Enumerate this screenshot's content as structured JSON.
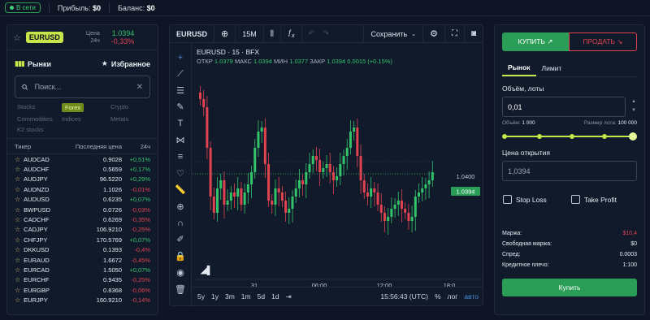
{
  "topbar": {
    "status": "В сети",
    "profit_label": "Прибыль:",
    "profit_value": "$0",
    "balance_label": "Баланс:",
    "balance_value": "$0"
  },
  "instrument": {
    "symbol": "EURUSD",
    "price_label": "Цена",
    "period_label": "24ч",
    "price": "1.0394",
    "change": "-0,33%"
  },
  "markets": {
    "title": "Рынки",
    "favorites": "Избранное",
    "search_placeholder": "Поиск...",
    "categories": [
      {
        "label": "Stocks",
        "active": false
      },
      {
        "label": "Forex",
        "active": true
      },
      {
        "label": "Crypto",
        "active": false
      },
      {
        "label": "Commodities",
        "active": false
      },
      {
        "label": "Indices",
        "active": false
      },
      {
        "label": "Metals",
        "active": false
      },
      {
        "label": "K2 stocks",
        "active": false
      }
    ],
    "columns": {
      "ticker": "Тикер",
      "last_price": "Последняя цена",
      "change": "24ч"
    },
    "rows": [
      {
        "ticker": "AUDCAD",
        "price": "0.9028",
        "change": "+0,51%",
        "dir": "up"
      },
      {
        "ticker": "AUDCHF",
        "price": "0.5659",
        "change": "+0,17%",
        "dir": "up"
      },
      {
        "ticker": "AUDJPY",
        "price": "96.5220",
        "change": "+0,29%",
        "dir": "up"
      },
      {
        "ticker": "AUDNZD",
        "price": "1.1026",
        "change": "-0,01%",
        "dir": "down"
      },
      {
        "ticker": "AUDUSD",
        "price": "0.6235",
        "change": "+0,07%",
        "dir": "up"
      },
      {
        "ticker": "BWPUSD",
        "price": "0.0726",
        "change": "-0,03%",
        "dir": "down"
      },
      {
        "ticker": "CADCHF",
        "price": "0.6269",
        "change": "-0,35%",
        "dir": "down"
      },
      {
        "ticker": "CADJPY",
        "price": "106.9210",
        "change": "-0,25%",
        "dir": "down"
      },
      {
        "ticker": "CHFJPY",
        "price": "170.5769",
        "change": "+0,07%",
        "dir": "up"
      },
      {
        "ticker": "DKKUSD",
        "price": "0.1393",
        "change": "-0,4%",
        "dir": "down"
      },
      {
        "ticker": "EURAUD",
        "price": "1.6672",
        "change": "-0,45%",
        "dir": "down"
      },
      {
        "ticker": "EURCAD",
        "price": "1.5050",
        "change": "+0,07%",
        "dir": "up"
      },
      {
        "ticker": "EURCHF",
        "price": "0.9435",
        "change": "-0,25%",
        "dir": "down"
      },
      {
        "ticker": "EURGBP",
        "price": "0.8368",
        "change": "-0,06%",
        "dir": "down"
      },
      {
        "ticker": "EURJPY",
        "price": "160.9210",
        "change": "-0,14%",
        "dir": "down"
      }
    ]
  },
  "chart": {
    "toolbar_symbol": "EURUSD",
    "interval": "15M",
    "save": "Сохранить",
    "title": "EURUSD · 15 · BFX",
    "ohlc": {
      "o_label": "ОТКР",
      "o": "1.0379",
      "h_label": "МАКС",
      "h": "1.0394",
      "l_label": "МИН",
      "l": "1.0377",
      "c_label": "ЗАКР",
      "c": "1.0394",
      "chg": "0.0015 (+0.15%)"
    },
    "price_marks": [
      "1.0400",
      "1.0394"
    ],
    "time_labels": [
      "31",
      "06:00",
      "12:00",
      "18:0"
    ],
    "ranges": [
      "5y",
      "1y",
      "3m",
      "1m",
      "5d",
      "1d"
    ],
    "clock": "15:56:43 (UTC)",
    "percent": "%",
    "log": "лог",
    "auto": "авто",
    "colors": {
      "up": "#33c36a",
      "down": "#e0424f"
    }
  },
  "order": {
    "buy_tab": "КУПИТЬ ↗",
    "sell_tab": "ПРОДАТЬ ↘",
    "tab_market": "Рынок",
    "tab_limit": "Лимит",
    "volume_label": "Объём, лоты",
    "volume_value": "0,01",
    "volume_info_label": "Объём:",
    "volume_info_value": "1 000",
    "lot_size_label": "Размер лота:",
    "lot_size_value": "100 000",
    "open_price_label": "Цена открытия",
    "open_price_value": "1,0394",
    "stop_loss": "Stop Loss",
    "take_profit": "Take Profit",
    "stats": [
      {
        "label": "Маржа:",
        "value": "$10,4",
        "color": "#e0424f"
      },
      {
        "label": "Свободная маржа:",
        "value": "$0",
        "color": "#e6eaf1"
      },
      {
        "label": "Спред:",
        "value": "0.0003",
        "color": "#e6eaf1"
      },
      {
        "label": "Кредитное плечо:",
        "value": "1:100",
        "color": "#e6eaf1"
      }
    ],
    "buy_button": "Купить"
  }
}
